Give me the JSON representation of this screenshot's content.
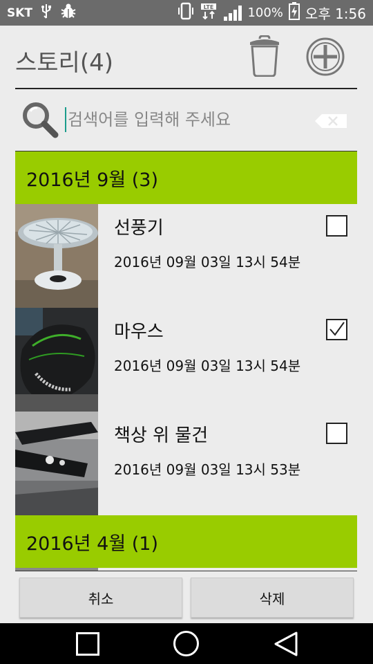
{
  "status_bar": {
    "carrier": "SKT",
    "battery": "100%",
    "time": "오후 1:56",
    "icons": [
      "usb-icon",
      "bug-icon",
      "vibrate-icon",
      "lte-icon",
      "signal-icon",
      "battery-charging-icon"
    ]
  },
  "header": {
    "title": "스토리(4)",
    "trash_icon": "trash-icon",
    "add_icon": "add-circle-icon"
  },
  "search": {
    "placeholder": "검색어를 입력해 주세요",
    "value": ""
  },
  "groups": [
    {
      "label": "2016년 9월 (3)",
      "items": [
        {
          "title": "선풍기",
          "date": "2016년 09월 03일 13시 54분",
          "checked": false
        },
        {
          "title": "마우스",
          "date": "2016년 09월 03일 13시 54분",
          "checked": true
        },
        {
          "title": "책상 위 물건",
          "date": "2016년 09월 03일 13시 53분",
          "checked": false
        }
      ]
    },
    {
      "label": "2016년 4월 (1)",
      "items": []
    }
  ],
  "buttons": {
    "cancel": "취소",
    "delete": "삭제"
  },
  "colors": {
    "group_header": "#99cc00",
    "status_bar": "#6b6b6b",
    "background": "#ececec"
  }
}
